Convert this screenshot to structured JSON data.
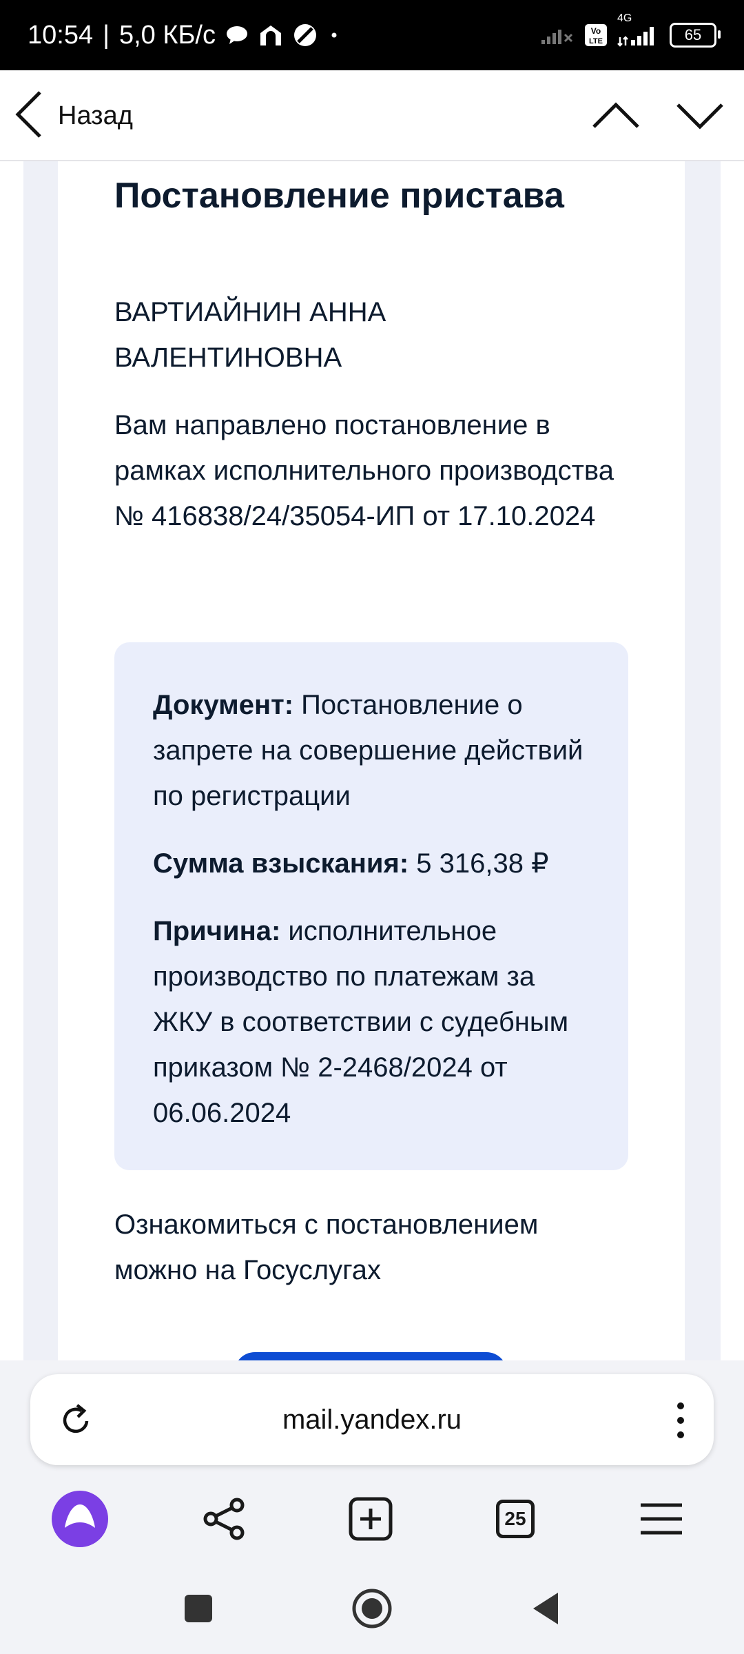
{
  "status_bar": {
    "time": "10:54",
    "separator": "|",
    "speed": "5,0 КБ/с",
    "network": "4G",
    "volte": "Vo LTE",
    "battery": "65"
  },
  "nav": {
    "back_label": "Назад"
  },
  "letter": {
    "title": "Постановление пристава",
    "recipient": "ВАРТИАЙНИН АННА ВАЛЕНТИНОВНА",
    "intro": "Вам направлено постановление в рамках исполнительного производства № 416838/24/35054-ИП от 17.10.2024",
    "details": {
      "document_label": "Документ:",
      "document_value": " Постановление о запрете на совершение действий по регистрации",
      "amount_label": "Сумма взыскания:",
      "amount_value": " 5 316,38 ₽",
      "reason_label": "Причина:",
      "reason_value": " исполнительное производство по платежам за ЖКУ в соответствии с судебным приказом № 2-2468/2024 от 06.06.2024"
    },
    "footer": "Ознакомиться с постановлением можно на Госуслугах"
  },
  "address_bar": {
    "url": "mail.yandex.ru"
  },
  "toolbar": {
    "tabs_count": "25"
  },
  "colors": {
    "alice": "#7b3fe4",
    "cta": "#0d4cd3",
    "infobox": "#eaeefb",
    "text": "#0d1b2e"
  }
}
